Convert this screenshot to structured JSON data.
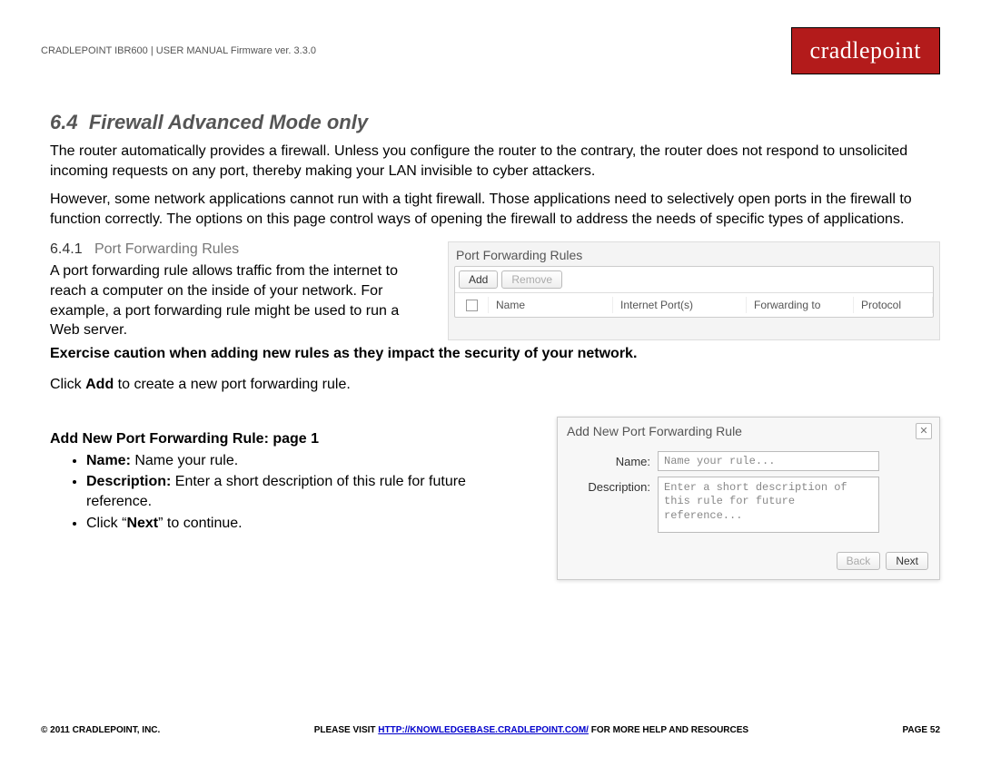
{
  "header": {
    "doc_line": "CRADLEPOINT IBR600 | USER MANUAL Firmware ver. 3.3.0",
    "logo": "cradlepoint"
  },
  "section": {
    "number": "6.4",
    "title": "Firewall Advanced Mode only",
    "para1": "The router automatically provides a firewall. Unless you configure the router to the contrary, the router does not respond to unsolicited incoming requests on any port, thereby making your LAN invisible to cyber attackers.",
    "para2": "However, some network applications cannot run with a tight firewall. Those applications need to selectively open ports in the firewall to function correctly. The options on this page control ways of opening the firewall to address the needs of specific types of applications."
  },
  "subsection": {
    "number": "6.4.1",
    "title": "Port Forwarding Rules",
    "para": "A port forwarding rule allows traffic from the internet to reach a computer on the inside of your network. For example, a port forwarding rule might be used to run a Web server.",
    "warn": "Exercise caution when adding new rules as they impact the security of your network.",
    "click_add_pre": "Click ",
    "click_add_bold": "Add",
    "click_add_post": " to create a new port forwarding rule."
  },
  "widget1": {
    "title": "Port Forwarding Rules",
    "add": "Add",
    "remove": "Remove",
    "cols": {
      "name": "Name",
      "inet": "Internet Port(s)",
      "fwd": "Forwarding to",
      "proto": "Protocol"
    }
  },
  "page1": {
    "heading": "Add New Port Forwarding Rule: page 1",
    "b1_label": "Name:",
    "b1_text": " Name your rule.",
    "b2_label": "Description:",
    "b2_text": " Enter a short description of this rule for future reference.",
    "b3_pre": "Click “",
    "b3_bold": "Next",
    "b3_post": "” to continue."
  },
  "widget2": {
    "title": "Add New Port Forwarding Rule",
    "name_label": "Name:",
    "name_placeholder": "Name your rule...",
    "desc_label": "Description:",
    "desc_placeholder": "Enter a short description of this rule for future reference...",
    "back": "Back",
    "next": "Next"
  },
  "footer": {
    "left": "© 2011 CRADLEPOINT, INC.",
    "mid_pre": "PLEASE VISIT ",
    "mid_link": "HTTP://KNOWLEDGEBASE.CRADLEPOINT.COM/",
    "mid_post": " FOR MORE HELP AND RESOURCES",
    "right": "PAGE 52"
  }
}
